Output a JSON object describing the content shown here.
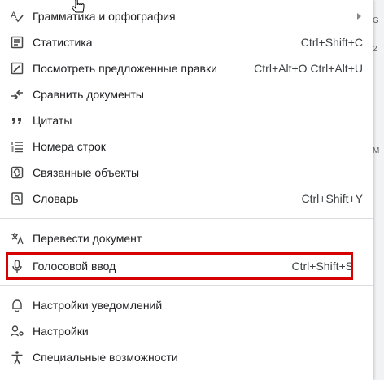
{
  "menu": {
    "items": [
      {
        "label": "Грамматика и орфография",
        "shortcut": "",
        "icon": "spellcheck-icon",
        "submenu": true
      },
      {
        "label": "Статистика",
        "shortcut": "Ctrl+Shift+C",
        "icon": "word-count-icon"
      },
      {
        "label": "Посмотреть предложенные правки",
        "shortcut": "Ctrl+Alt+O Ctrl+Alt+U",
        "icon": "review-edits-icon"
      },
      {
        "label": "Сравнить документы",
        "shortcut": "",
        "icon": "compare-icon"
      },
      {
        "label": "Цитаты",
        "shortcut": "",
        "icon": "quote-icon"
      },
      {
        "label": "Номера строк",
        "shortcut": "",
        "icon": "line-numbers-icon"
      },
      {
        "label": "Связанные объекты",
        "shortcut": "",
        "icon": "link-icon"
      },
      {
        "label": "Словарь",
        "shortcut": "Ctrl+Shift+Y",
        "icon": "dictionary-icon"
      },
      {
        "label": "Перевести документ",
        "shortcut": "",
        "icon": "translate-icon"
      },
      {
        "label": "Голосовой ввод",
        "shortcut": "Ctrl+Shift+S",
        "icon": "microphone-icon",
        "highlighted": true
      },
      {
        "label": "Настройки уведомлений",
        "shortcut": "",
        "icon": "bell-icon"
      },
      {
        "label": "Настройки",
        "shortcut": "",
        "icon": "user-settings-icon"
      },
      {
        "label": "Специальные возможности",
        "shortcut": "",
        "icon": "accessibility-icon"
      }
    ]
  },
  "background": {
    "fragments": [
      "G",
      "2",
      "M"
    ]
  },
  "colors": {
    "highlight": "#d50000",
    "divider": "#dadce0",
    "icon": "#444746"
  }
}
